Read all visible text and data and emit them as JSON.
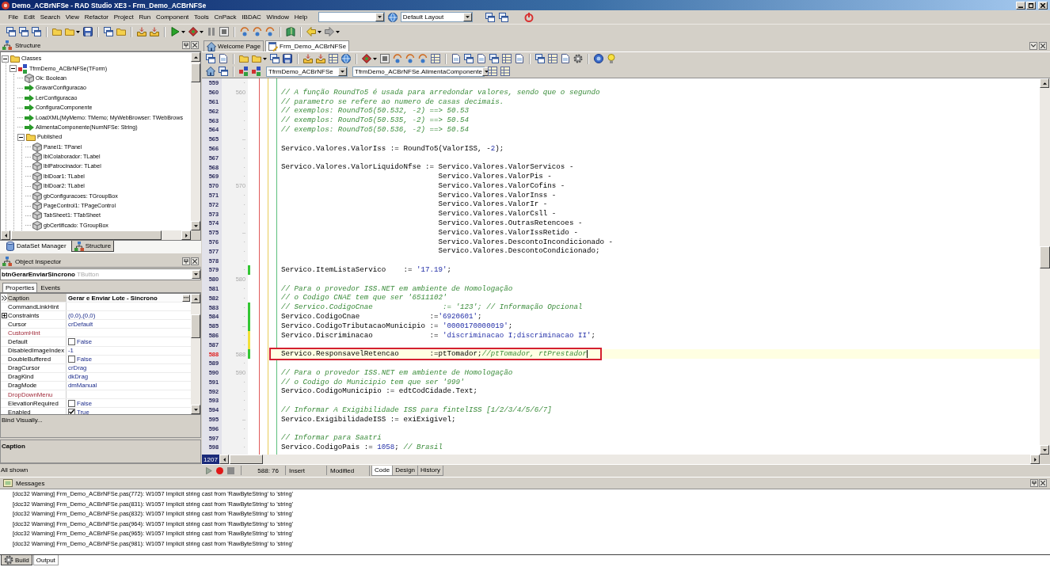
{
  "window": {
    "title": "Demo_ACBrNFSe - RAD Studio XE3 - Frm_Demo_ACBrNFSe"
  },
  "menu": [
    "File",
    "Edit",
    "Search",
    "View",
    "Refactor",
    "Project",
    "Run",
    "Component",
    "Tools",
    "CnPack",
    "IBDAC",
    "Window",
    "Help"
  ],
  "layout_combo": {
    "value": "Default Layout"
  },
  "structure": {
    "title": "Structure",
    "tree": [
      {
        "label": "Classes",
        "kind": "folder",
        "expanded": true,
        "children": [
          {
            "label": "TfrmDemo_ACBrNFSe(TForm)",
            "kind": "class",
            "expanded": true,
            "children": [
              {
                "label": "Ok: Boolean",
                "kind": "field"
              },
              {
                "label": "GravarConfiguracao",
                "kind": "method"
              },
              {
                "label": "LerConfiguracao",
                "kind": "method"
              },
              {
                "label": "ConfiguraComponente",
                "kind": "method"
              },
              {
                "label": "LoadXML(MyMemo: TMemo; MyWebBrowser: TWebBrows",
                "kind": "method"
              },
              {
                "label": "AlimentaComponente(NumNFSe: String)",
                "kind": "method"
              },
              {
                "label": "Published",
                "kind": "folder",
                "expanded": true,
                "children": [
                  {
                    "label": "Panel1: TPanel",
                    "kind": "field"
                  },
                  {
                    "label": "lblColaborador: TLabel",
                    "kind": "field"
                  },
                  {
                    "label": "lblPatrocinador: TLabel",
                    "kind": "field"
                  },
                  {
                    "label": "lblDoar1: TLabel",
                    "kind": "field"
                  },
                  {
                    "label": "lblDoar2: TLabel",
                    "kind": "field"
                  },
                  {
                    "label": "gbConfiguracoes: TGroupBox",
                    "kind": "field"
                  },
                  {
                    "label": "PageControl1: TPageControl",
                    "kind": "field"
                  },
                  {
                    "label": "TabSheet1: TTabSheet",
                    "kind": "field"
                  },
                  {
                    "label": "gbCertificado: TGroupBox",
                    "kind": "field"
                  }
                ]
              }
            ]
          }
        ]
      }
    ],
    "tabs": [
      {
        "label": "DataSet Manager",
        "selected": false
      },
      {
        "label": "Structure",
        "selected": true
      }
    ]
  },
  "object_inspector": {
    "title": "Object Inspector",
    "component": {
      "name": "btnGerarEnviarSincrono",
      "type": "TButton"
    },
    "tabs": [
      {
        "label": "Properties",
        "selected": true
      },
      {
        "label": "Events",
        "selected": false
      }
    ],
    "properties": [
      {
        "name": "Caption",
        "value": "Gerar e Enviar Lote - Sincrono",
        "kind": "text",
        "selected": true
      },
      {
        "name": "CommandLinkHint",
        "kind": "text",
        "selected": false
      },
      {
        "name": "Constraints",
        "value": "(0,0),(0,0)",
        "kind": "set",
        "expanded": false,
        "selected": false
      },
      {
        "name": "Cursor",
        "value": "crDefault",
        "kind": "text",
        "selected": false
      },
      {
        "name": "CustomHint",
        "kind": "reference",
        "selected": false
      },
      {
        "name": "Default",
        "value": "False",
        "kind": "boolean",
        "checked": false,
        "selected": false
      },
      {
        "name": "DisabledImageIndex",
        "value": "-1",
        "kind": "text",
        "selected": false
      },
      {
        "name": "DoubleBuffered",
        "value": "False",
        "kind": "boolean",
        "checked": false,
        "selected": false
      },
      {
        "name": "DragCursor",
        "value": "crDrag",
        "kind": "text",
        "selected": false
      },
      {
        "name": "DragKind",
        "value": "dkDrag",
        "kind": "text",
        "selected": false
      },
      {
        "name": "DragMode",
        "value": "dmManual",
        "kind": "text",
        "selected": false
      },
      {
        "name": "DropDownMenu",
        "kind": "reference",
        "selected": false
      },
      {
        "name": "ElevationRequired",
        "value": "False",
        "kind": "boolean",
        "checked": false,
        "selected": false
      },
      {
        "name": "Enabled",
        "value": "True",
        "kind": "boolean",
        "checked": true,
        "selected": false
      }
    ],
    "bind_link": "Bind Visually...",
    "description": "Caption",
    "status": "All shown"
  },
  "editor": {
    "tabs": [
      {
        "label": "Welcome Page",
        "selected": false
      },
      {
        "label": "Frm_Demo_ACBrNFSe",
        "selected": true
      }
    ],
    "class_combo": "TfrmDemo_ACBrNFSe",
    "method_combo": "TfrmDemo_ACBrNFSe.AlimentaComponente",
    "lines": [
      {
        "number": "559",
        "gutter": "·",
        "current": false,
        "annotated": false
      },
      {
        "number": "560",
        "gutter": "560",
        "current": false,
        "annotated": false,
        "segments": [
          {
            "kind": "comment",
            "text": "// A função RoundTo5 é usada para arredondar valores, sendo que o segundo"
          }
        ]
      },
      {
        "number": "561",
        "gutter": "·",
        "current": false,
        "annotated": false,
        "segments": [
          {
            "kind": "comment",
            "text": "// parametro se refere ao numero de casas decimais."
          }
        ]
      },
      {
        "number": "562",
        "gutter": "·",
        "current": false,
        "annotated": false,
        "segments": [
          {
            "kind": "comment",
            "text": "// exemplos: RoundTo5(50.532, -2) ==> 50.53"
          }
        ]
      },
      {
        "number": "563",
        "gutter": "·",
        "current": false,
        "annotated": false,
        "segments": [
          {
            "kind": "comment",
            "text": "// exemplos: RoundTo5(50.535, -2) ==> 50.54"
          }
        ]
      },
      {
        "number": "564",
        "gutter": "·",
        "current": false,
        "annotated": false,
        "segments": [
          {
            "kind": "comment",
            "text": "// exemplos: RoundTo5(50.536, -2) ==> 50.54"
          }
        ]
      },
      {
        "number": "565",
        "gutter": "–",
        "current": false,
        "annotated": false
      },
      {
        "number": "566",
        "gutter": "·",
        "current": false,
        "annotated": false,
        "segments": [
          {
            "kind": "code",
            "text": "Servico.Valores.ValorIss := RoundTo5(ValorISS, -"
          },
          {
            "kind": "number",
            "text": "2"
          },
          {
            "kind": "code",
            "text": ");"
          }
        ]
      },
      {
        "number": "567",
        "gutter": "·",
        "current": false,
        "annotated": false
      },
      {
        "number": "568",
        "gutter": "·",
        "current": false,
        "annotated": false,
        "segments": [
          {
            "kind": "code",
            "text": "Servico.Valores.ValorLiquidoNfse := Servico.Valores.ValorServicos -"
          }
        ]
      },
      {
        "number": "569",
        "gutter": "·",
        "current": false,
        "annotated": false,
        "segments": [
          {
            "kind": "code",
            "text": "                                    Servico.Valores.ValorPis -"
          }
        ]
      },
      {
        "number": "570",
        "gutter": "570",
        "current": false,
        "annotated": false,
        "segments": [
          {
            "kind": "code",
            "text": "                                    Servico.Valores.ValorCofins -"
          }
        ]
      },
      {
        "number": "571",
        "gutter": "·",
        "current": false,
        "annotated": false,
        "segments": [
          {
            "kind": "code",
            "text": "                                    Servico.Valores.ValorInss -"
          }
        ]
      },
      {
        "number": "572",
        "gutter": "·",
        "current": false,
        "annotated": false,
        "segments": [
          {
            "kind": "code",
            "text": "                                    Servico.Valores.ValorIr -"
          }
        ]
      },
      {
        "number": "573",
        "gutter": "·",
        "current": false,
        "annotated": false,
        "segments": [
          {
            "kind": "code",
            "text": "                                    Servico.Valores.ValorCsll -"
          }
        ]
      },
      {
        "number": "574",
        "gutter": "·",
        "current": false,
        "annotated": false,
        "segments": [
          {
            "kind": "code",
            "text": "                                    Servico.Valores.OutrasRetencoes -"
          }
        ]
      },
      {
        "number": "575",
        "gutter": "–",
        "current": false,
        "annotated": false,
        "segments": [
          {
            "kind": "code",
            "text": "                                    Servico.Valores.ValorIssRetido -"
          }
        ]
      },
      {
        "number": "576",
        "gutter": "·",
        "current": false,
        "annotated": false,
        "segments": [
          {
            "kind": "code",
            "text": "                                    Servico.Valores.DescontoIncondicionado -"
          }
        ]
      },
      {
        "number": "577",
        "gutter": "·",
        "current": false,
        "annotated": false,
        "segments": [
          {
            "kind": "code",
            "text": "                                    Servico.Valores.DescontoCondicionado;"
          }
        ]
      },
      {
        "number": "578",
        "gutter": "·",
        "current": false,
        "annotated": false
      },
      {
        "number": "579",
        "gutter": "·",
        "color": "#33c633",
        "current": false,
        "annotated": false,
        "segments": [
          {
            "kind": "code",
            "text": "Servico.ItemListaServico    := "
          },
          {
            "kind": "string",
            "text": "'17.19'"
          },
          {
            "kind": "code",
            "text": ";"
          }
        ]
      },
      {
        "number": "580",
        "gutter": "580",
        "current": false,
        "annotated": false
      },
      {
        "number": "581",
        "gutter": "·",
        "current": false,
        "annotated": false,
        "segments": [
          {
            "kind": "comment",
            "text": "// Para o provedor ISS.NET em ambiente de Homologação"
          }
        ]
      },
      {
        "number": "582",
        "gutter": "·",
        "current": false,
        "annotated": false,
        "segments": [
          {
            "kind": "comment",
            "text": "// o Codigo CNAE tem que ser '6511102'"
          }
        ]
      },
      {
        "number": "583",
        "gutter": "·",
        "color": "#33c633",
        "current": false,
        "annotated": false,
        "segments": [
          {
            "kind": "comment",
            "text": "// Servico.CodigoCnae                := '123'; // Informação Opcional"
          }
        ]
      },
      {
        "number": "584",
        "gutter": "·",
        "color": "#33c633",
        "current": false,
        "annotated": false,
        "segments": [
          {
            "kind": "code",
            "text": "Servico.CodigoCnae                :="
          },
          {
            "kind": "string",
            "text": "'6920601'"
          },
          {
            "kind": "code",
            "text": ";"
          }
        ]
      },
      {
        "number": "585",
        "gutter": "–",
        "color": "#33c633",
        "current": false,
        "annotated": false,
        "segments": [
          {
            "kind": "code",
            "text": "Servico.CodigoTributacaoMunicipio := "
          },
          {
            "kind": "string",
            "text": "'0000170000019'"
          },
          {
            "kind": "code",
            "text": ";"
          }
        ]
      },
      {
        "number": "586",
        "gutter": "·",
        "color": "#f2e03c",
        "current": false,
        "annotated": false,
        "segments": [
          {
            "kind": "code",
            "text": "Servico.Discriminacao             := "
          },
          {
            "kind": "string",
            "text": "'discriminacao I;discriminacao II'"
          },
          {
            "kind": "code",
            "text": ";"
          }
        ]
      },
      {
        "number": "587",
        "gutter": "·",
        "color": "#f2e03c",
        "current": false,
        "annotated": false
      },
      {
        "number": "588",
        "gutter": "588",
        "color": "#33c633",
        "current": true,
        "annotated": true,
        "segments": [
          {
            "kind": "code",
            "text": "Servico.ResponsavelRetencao       :=ptTomador;"
          },
          {
            "kind": "comment",
            "text": "//ptTomador, rtPrestador"
          }
        ]
      },
      {
        "number": "589",
        "gutter": "·",
        "current": false,
        "annotated": false
      },
      {
        "number": "590",
        "gutter": "590",
        "current": false,
        "annotated": false,
        "segments": [
          {
            "kind": "comment",
            "text": "// Para o provedor ISS.NET em ambiente de Homologação"
          }
        ]
      },
      {
        "number": "591",
        "gutter": "·",
        "current": false,
        "annotated": false,
        "segments": [
          {
            "kind": "comment",
            "text": "// o Codigo do Municipio tem que ser '999'"
          }
        ]
      },
      {
        "number": "592",
        "gutter": "·",
        "current": false,
        "annotated": false,
        "segments": [
          {
            "kind": "code",
            "text": "Servico.CodigoMunicipio := edtCodCidade.Text;"
          }
        ]
      },
      {
        "number": "593",
        "gutter": "·",
        "current": false,
        "annotated": false
      },
      {
        "number": "594",
        "gutter": "·",
        "current": false,
        "annotated": false,
        "segments": [
          {
            "kind": "comment",
            "text": "// Informar A Exigibilidade ISS para fintelISS [1/2/3/4/5/6/7]"
          }
        ]
      },
      {
        "number": "595",
        "gutter": "–",
        "current": false,
        "annotated": false,
        "segments": [
          {
            "kind": "code",
            "text": "Servico.ExigibilidadeISS := exiExigivel;"
          }
        ]
      },
      {
        "number": "596",
        "gutter": "·",
        "current": false,
        "annotated": false
      },
      {
        "number": "597",
        "gutter": "·",
        "current": false,
        "annotated": false,
        "segments": [
          {
            "kind": "comment",
            "text": "// Informar para Saatri"
          }
        ]
      },
      {
        "number": "598",
        "gutter": "·",
        "current": false,
        "annotated": false,
        "segments": [
          {
            "kind": "code",
            "text": "Servico.CodigoPais := "
          },
          {
            "kind": "number",
            "text": "1058"
          },
          {
            "kind": "code",
            "text": "; "
          },
          {
            "kind": "comment",
            "text": "// Brasil"
          }
        ]
      }
    ],
    "badge": "1207",
    "status": {
      "position": "588: 76",
      "mode": "Insert",
      "state": "Modified"
    },
    "view_tabs": [
      {
        "label": "Code",
        "selected": true
      },
      {
        "label": "Design",
        "selected": false
      },
      {
        "label": "History",
        "selected": false
      }
    ]
  },
  "messages": {
    "title": "Messages",
    "lines": [
      "[dcc32 Warning] Frm_Demo_ACBrNFSe.pas(772): W1057 Implicit string cast from 'RawByteString' to 'string'",
      "[dcc32 Warning] Frm_Demo_ACBrNFSe.pas(831): W1057 Implicit string cast from 'RawByteString' to 'string'",
      "[dcc32 Warning] Frm_Demo_ACBrNFSe.pas(832): W1057 Implicit string cast from 'RawByteString' to 'string'",
      "[dcc32 Warning] Frm_Demo_ACBrNFSe.pas(964): W1057 Implicit string cast from 'RawByteString' to 'string'",
      "[dcc32 Warning] Frm_Demo_ACBrNFSe.pas(965): W1057 Implicit string cast from 'RawByteString' to 'string'",
      "[dcc32 Warning] Frm_Demo_ACBrNFSe.pas(981): W1057 Implicit string cast from 'RawByteString' to 'string'"
    ]
  },
  "bottom_tabs": [
    {
      "label": "Build",
      "selected": true
    },
    {
      "label": "Output",
      "selected": false
    }
  ]
}
